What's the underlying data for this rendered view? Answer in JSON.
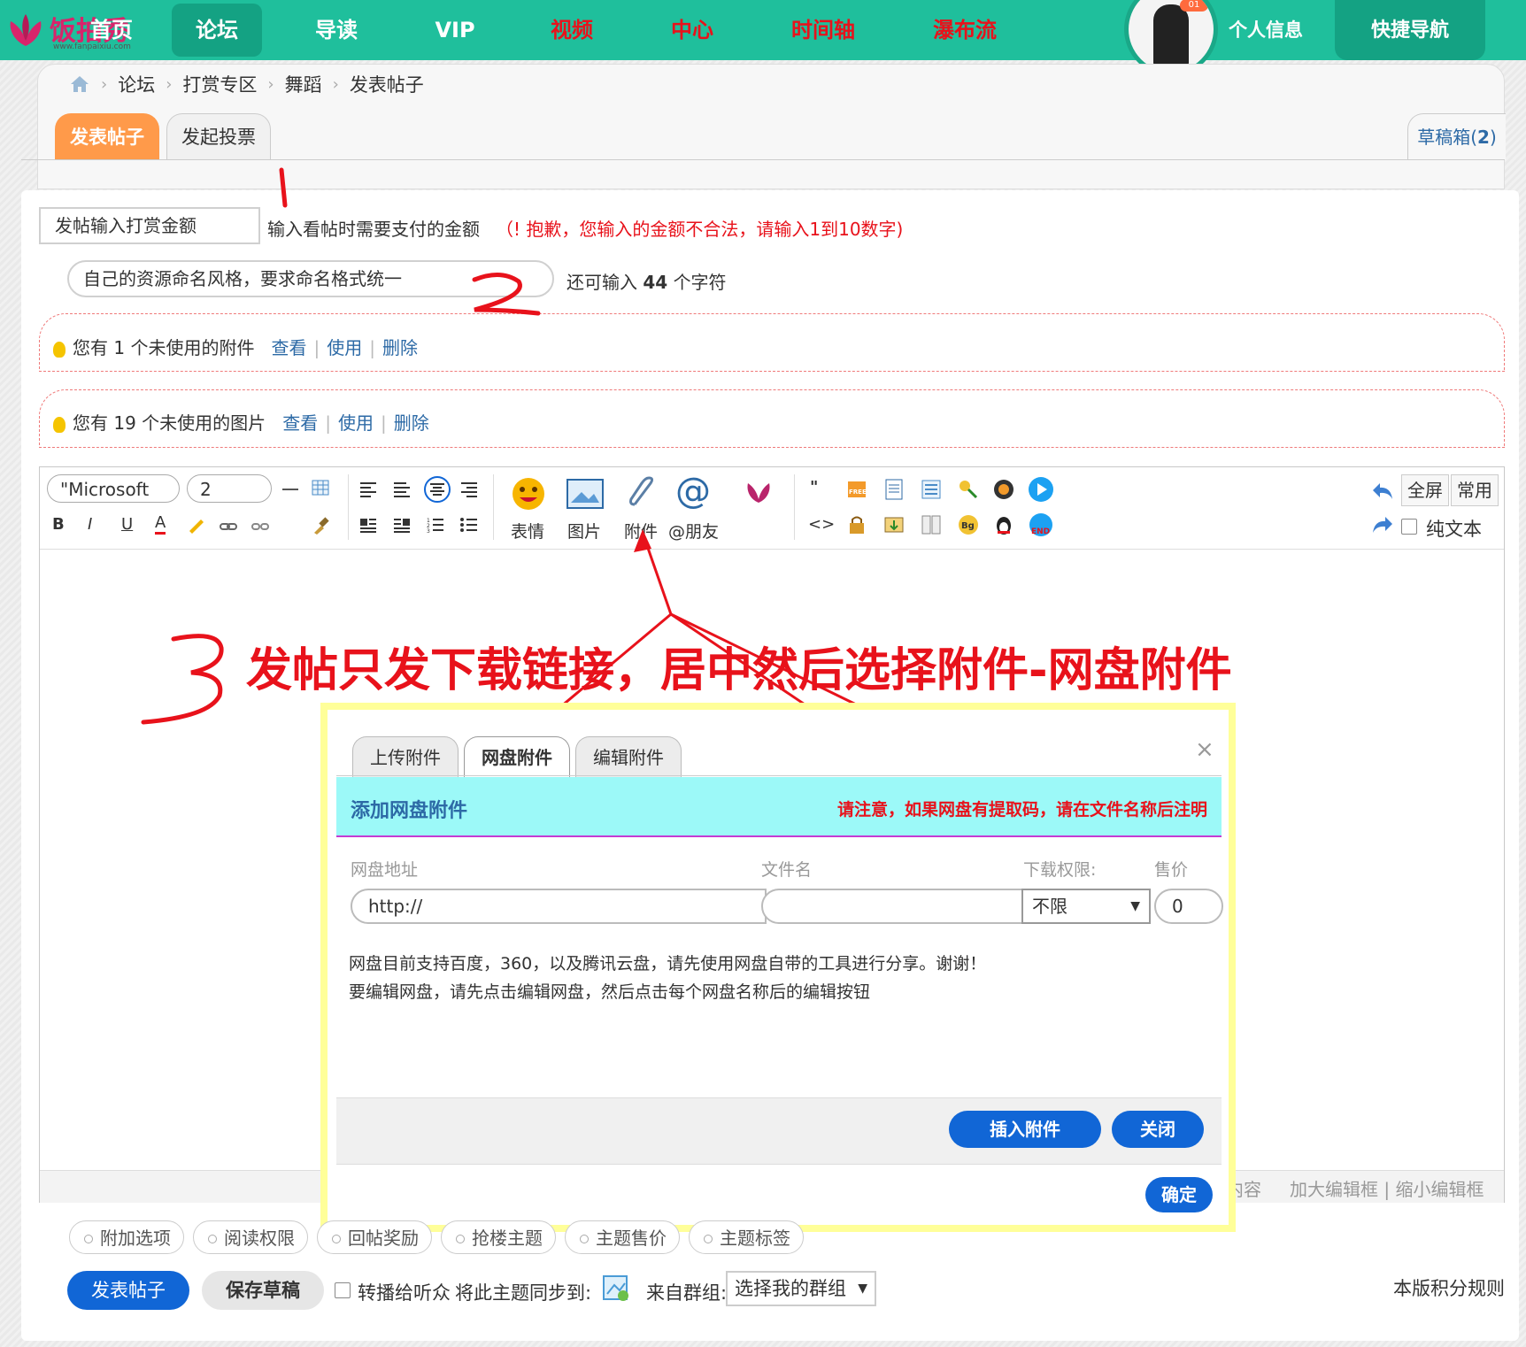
{
  "nav": {
    "logo_text": "饭拍秀",
    "logo_sub": "www.fanpaixiu.com",
    "items": [
      {
        "label": "首页",
        "color": "white"
      },
      {
        "label": "论坛",
        "color": "white",
        "active": true
      },
      {
        "label": "导读",
        "color": "white"
      },
      {
        "label": "VIP",
        "color": "white"
      },
      {
        "label": "视频",
        "color": "red"
      },
      {
        "label": "中心",
        "color": "red"
      },
      {
        "label": "时间轴",
        "color": "red"
      },
      {
        "label": "瀑布流",
        "color": "red"
      }
    ],
    "avatar_badge": "01",
    "profile_label": "个人信息",
    "quicknav_label": "快捷导航"
  },
  "breadcrumb": [
    "论坛",
    "打赏专区",
    "舞蹈",
    "发表帖子"
  ],
  "tabs": [
    {
      "label": "发表帖子",
      "active": true
    },
    {
      "label": "发起投票",
      "active": false
    }
  ],
  "draft_label": "草稿箱",
  "draft_count": "2",
  "form": {
    "reward_placeholder": "发帖输入打赏金额",
    "reward_hint": "输入看帖时需要支付的金额",
    "reward_error": "（! 抱歉，您输入的金额不合法，请输入1到10数字)",
    "title_placeholder": "自己的资源命名风格，要求命名格式统一",
    "remaining_prefix": "还可输入",
    "remaining_count": "44",
    "remaining_suffix": "个字符"
  },
  "attach_notice": {
    "prefix": "您有",
    "count": "1",
    "suffix": "个未使用的附件",
    "view": "查看",
    "use": "使用",
    "delete": "删除"
  },
  "image_notice": {
    "prefix": "您有",
    "count": "19",
    "suffix": "个未使用的图片",
    "view": "查看",
    "use": "使用",
    "delete": "删除"
  },
  "editor": {
    "font_select": "\"Microsoft",
    "size_select": "2",
    "emoji_label": "表情",
    "image_label": "图片",
    "attach_label": "附件",
    "mention_label": "@朋友",
    "fullscreen_label": "全屏",
    "common_label": "常用",
    "plaintext_label": "纯文本",
    "footer_partial": "内容",
    "enlarge_label": "加大编辑框",
    "shrink_label": "缩小编辑框"
  },
  "annotations": {
    "mark1": "1",
    "mark2": "2",
    "mark3": "3",
    "instruction": "发帖只发下载链接，居中然后选择附件-网盘附件"
  },
  "dialog": {
    "tabs": [
      "上传附件",
      "网盘附件",
      "编辑附件"
    ],
    "active_tab": "网盘附件",
    "close_icon": "×",
    "header_title": "添加网盘附件",
    "header_notice": "请注意，如果网盘有提取码，请在文件名称后注明",
    "label_url": "网盘地址",
    "label_filename": "文件名",
    "label_permission": "下载权限:",
    "label_price": "售价",
    "url_value": "http://",
    "filename_value": "",
    "permission_value": "不限",
    "price_value": "0",
    "note_line1": "网盘目前支持百度，360，以及腾讯云盘，请先使用网盘自带的工具进行分享。谢谢！",
    "note_line2": "要编辑网盘，请先点击编辑网盘，然后点击每个网盘名称后的编辑按钮",
    "insert_button": "插入附件",
    "close_button": "关闭",
    "confirm_button": "确定"
  },
  "bottom": {
    "options": [
      "附加选项",
      "阅读权限",
      "回帖奖励",
      "抢楼主题",
      "主题售价",
      "主题标签"
    ],
    "post_button": "发表帖子",
    "save_button": "保存草稿",
    "broadcast_label": "转播给听众",
    "sync_label": "将此主题同步到:",
    "group_label": "来自群组:",
    "group_select": "选择我的群组",
    "rules_link": "本版积分规则"
  },
  "colors": {
    "nav_bg": "#1fbf9c",
    "nav_active": "#14a283",
    "accent_red": "#e8121b",
    "link_blue": "#2d6aa6",
    "primary_btn": "#1166d6",
    "tab_active": "#ff9a4a",
    "dialog_header": "#9cf9f8",
    "dialog_border": "#ffff99"
  }
}
